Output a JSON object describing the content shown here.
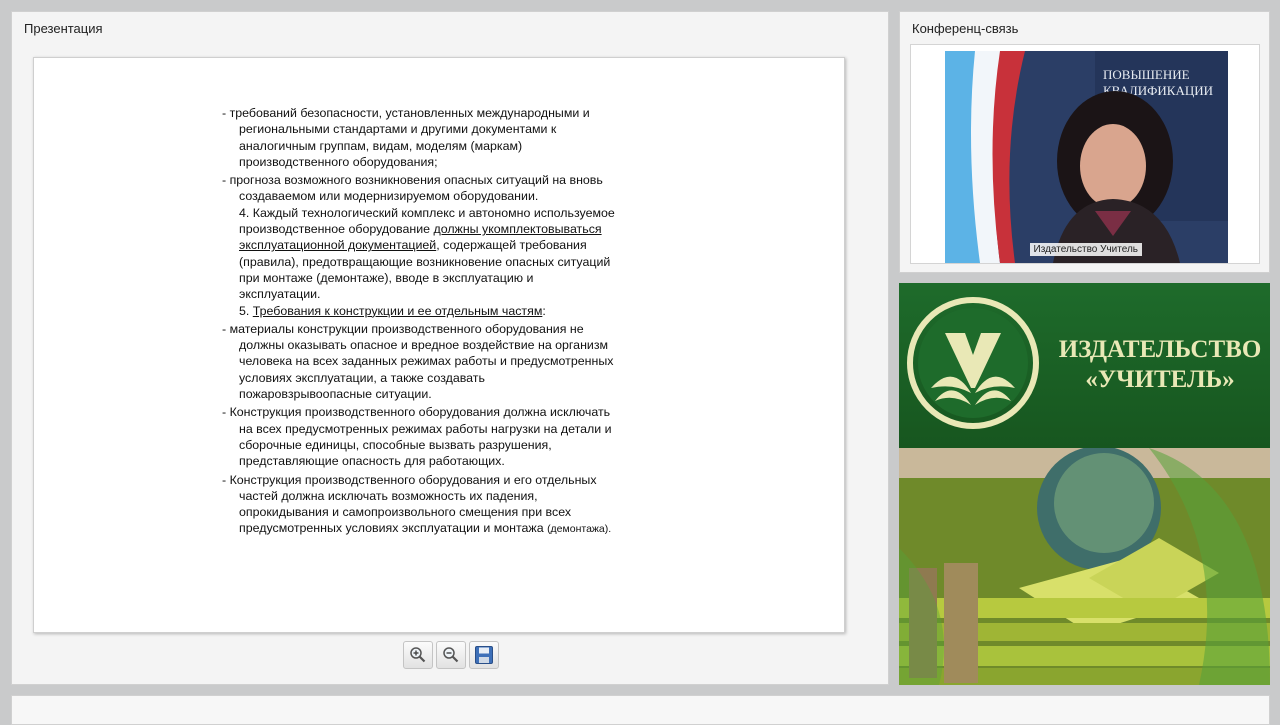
{
  "presentation": {
    "title": "Презентация",
    "slide": {
      "paragraphs": [
        {
          "lines": [
            "- требований безопасности, установленных международными и",
            "региональными стандартами и другими документами к",
            "аналогичным группам, видам, моделям (маркам)",
            "производственного оборудования;"
          ]
        },
        {
          "lines": [
            "- прогноза возможного возникновения опасных ситуаций на вновь",
            "создаваемом или модернизируемом оборудовании."
          ]
        },
        {
          "item4_a": "4. Каждый технологический комплекс и автономно используемое",
          "item4_b": "производственное оборудование ",
          "item4_u1": "должны укомплектовываться",
          "item4_u2": "эксплуатационной документацией",
          "item4_c": ", содержащей требования",
          "item4_d": "(правила), предотвращающие возникновение опасных ситуаций",
          "item4_e": "при монтаже (демонтаже), вводе в эксплуатацию и",
          "item4_f": "эксплуатации."
        },
        {
          "item5_num": "5. ",
          "item5_u": "Требования к конструкции и ее отдельным частям",
          "item5_tail": ":"
        },
        {
          "lines": [
            "- материалы конструкции производственного оборудования не",
            "должны оказывать опасное и вредное воздействие на организм",
            "человека на всех заданных режимах работы и предусмотренных",
            "условиях  эксплуатации, а также создавать",
            "пожаровзрывоопасные ситуации."
          ]
        },
        {
          "lines": [
            "- Конструкция производственного оборудования должна исключать",
            "на всех предусмотренных режимах работы нагрузки на детали и",
            "сборочные единицы, способные вызвать разрушения,",
            "представляющие опасность для работающих."
          ]
        },
        {
          "lines": [
            "- Конструкция производственного оборудования и его отдельных",
            "частей должна исключать возможность их падения,",
            "опрокидывания и самопроизвольного смещения при всех"
          ],
          "last": "предусмотренных условиях эксплуатации и монтажа ",
          "last_small": "(демонтажа)."
        }
      ]
    },
    "toolbar": {
      "icons": [
        "zoom-in-icon",
        "zoom-out-icon",
        "save-icon"
      ]
    }
  },
  "conference": {
    "title": "Конференц-связь",
    "video_label": "Издательство Учитель",
    "backdrop_text": "ПОВЫШЕНИЕ\nКВАЛИФИКАЦИИ"
  },
  "logo": {
    "line1": "ИЗДАТЕЛЬСТВО",
    "line2": "«УЧИТЕЛЬ»",
    "colors": {
      "green": "#1e6b2b",
      "cream": "#e9e8b6"
    }
  }
}
